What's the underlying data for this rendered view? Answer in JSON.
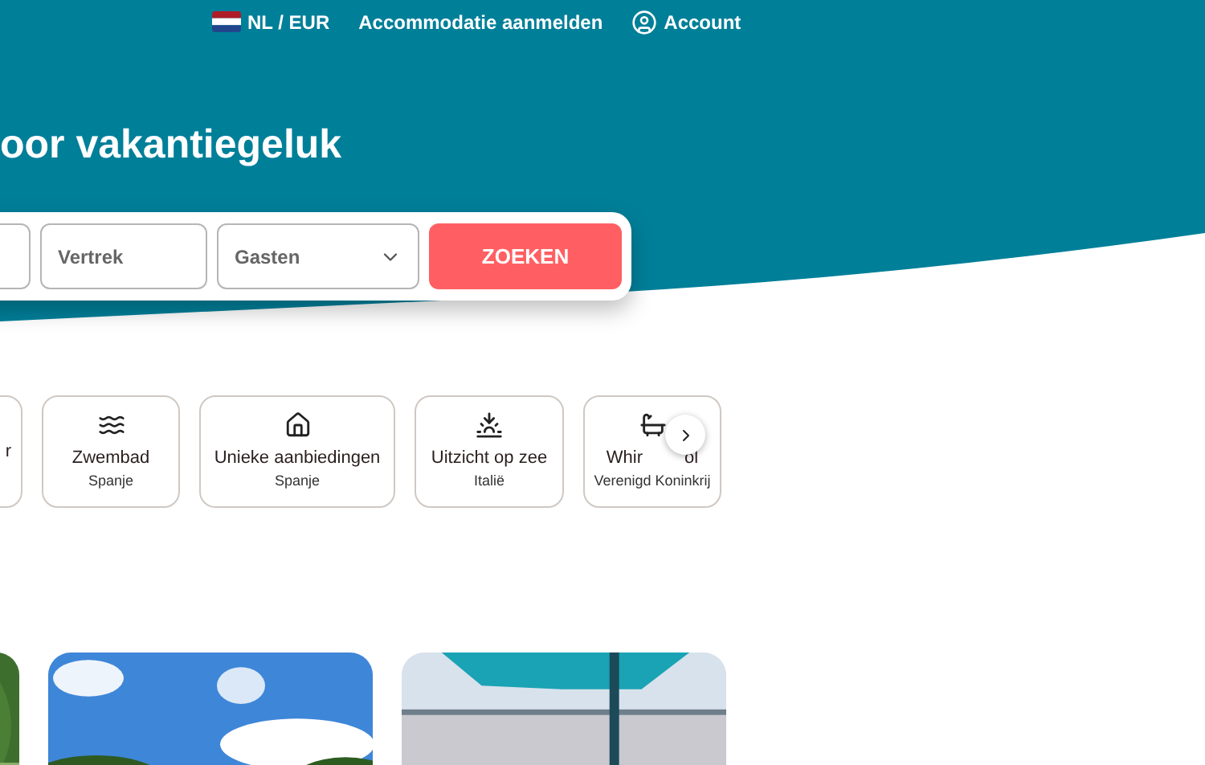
{
  "top_nav": {
    "language": "NL / EUR",
    "links": [
      "Accommodatie aanmelden"
    ],
    "account": "Account"
  },
  "hero": {
    "title": "oor vakantiegeluk"
  },
  "search": {
    "fields": [
      {
        "kind": "blank"
      },
      {
        "kind": "date",
        "placeholder": "Vertrek"
      },
      {
        "kind": "select",
        "placeholder": "Gasten"
      }
    ],
    "button": "ZOEKEN"
  },
  "categories": [
    {
      "kind": "partial",
      "title": "r"
    },
    {
      "kind": "swim",
      "title": "Zwembad",
      "subtitle": "Spanje"
    },
    {
      "kind": "deal",
      "title": "Unieke aanbiedingen",
      "subtitle": "Spanje"
    },
    {
      "kind": "sea",
      "title": "Uitzicht op zee",
      "subtitle": "Italië"
    },
    {
      "kind": "tub",
      "title": "Whir",
      "title_end": "ol",
      "subtitle": "Verenigd Koninkrij"
    }
  ]
}
